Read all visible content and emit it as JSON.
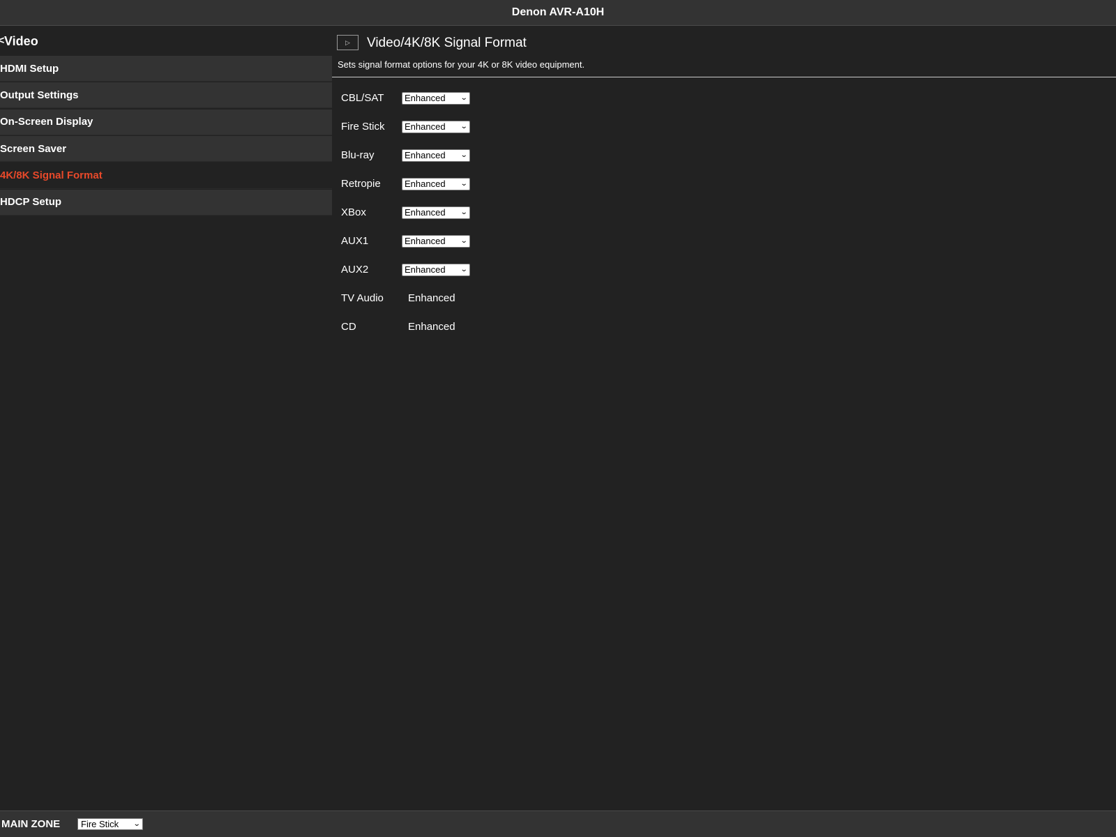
{
  "app": {
    "title": "Denon AVR-A10H"
  },
  "sidebar": {
    "back_icon": "<",
    "header": "Video",
    "items": [
      {
        "label": "HDMI Setup",
        "active": false
      },
      {
        "label": "Output Settings",
        "active": false
      },
      {
        "label": "On-Screen Display",
        "active": false
      },
      {
        "label": "Screen Saver",
        "active": false
      },
      {
        "label": "4K/8K Signal Format",
        "active": true
      },
      {
        "label": "HDCP Setup",
        "active": false
      }
    ]
  },
  "content": {
    "play_icon": "▷",
    "title": "Video/4K/8K Signal Format",
    "description": "Sets signal format options for your 4K or 8K video equipment.",
    "rows": [
      {
        "label": "CBL/SAT",
        "value": "Enhanced",
        "editable": true
      },
      {
        "label": "Fire Stick",
        "value": "Enhanced",
        "editable": true
      },
      {
        "label": "Blu-ray",
        "value": "Enhanced",
        "editable": true
      },
      {
        "label": "Retropie",
        "value": "Enhanced",
        "editable": true
      },
      {
        "label": "XBox",
        "value": "Enhanced",
        "editable": true
      },
      {
        "label": "AUX1",
        "value": "Enhanced",
        "editable": true
      },
      {
        "label": "AUX2",
        "value": "Enhanced",
        "editable": true
      },
      {
        "label": "TV Audio",
        "value": "Enhanced",
        "editable": false
      },
      {
        "label": "CD",
        "value": "Enhanced",
        "editable": false
      }
    ]
  },
  "footer": {
    "zone_label": "MAIN ZONE",
    "zone_source": "Fire Stick"
  },
  "colors": {
    "background": "#222222",
    "panel": "#333333",
    "accent": "#e8492a"
  }
}
